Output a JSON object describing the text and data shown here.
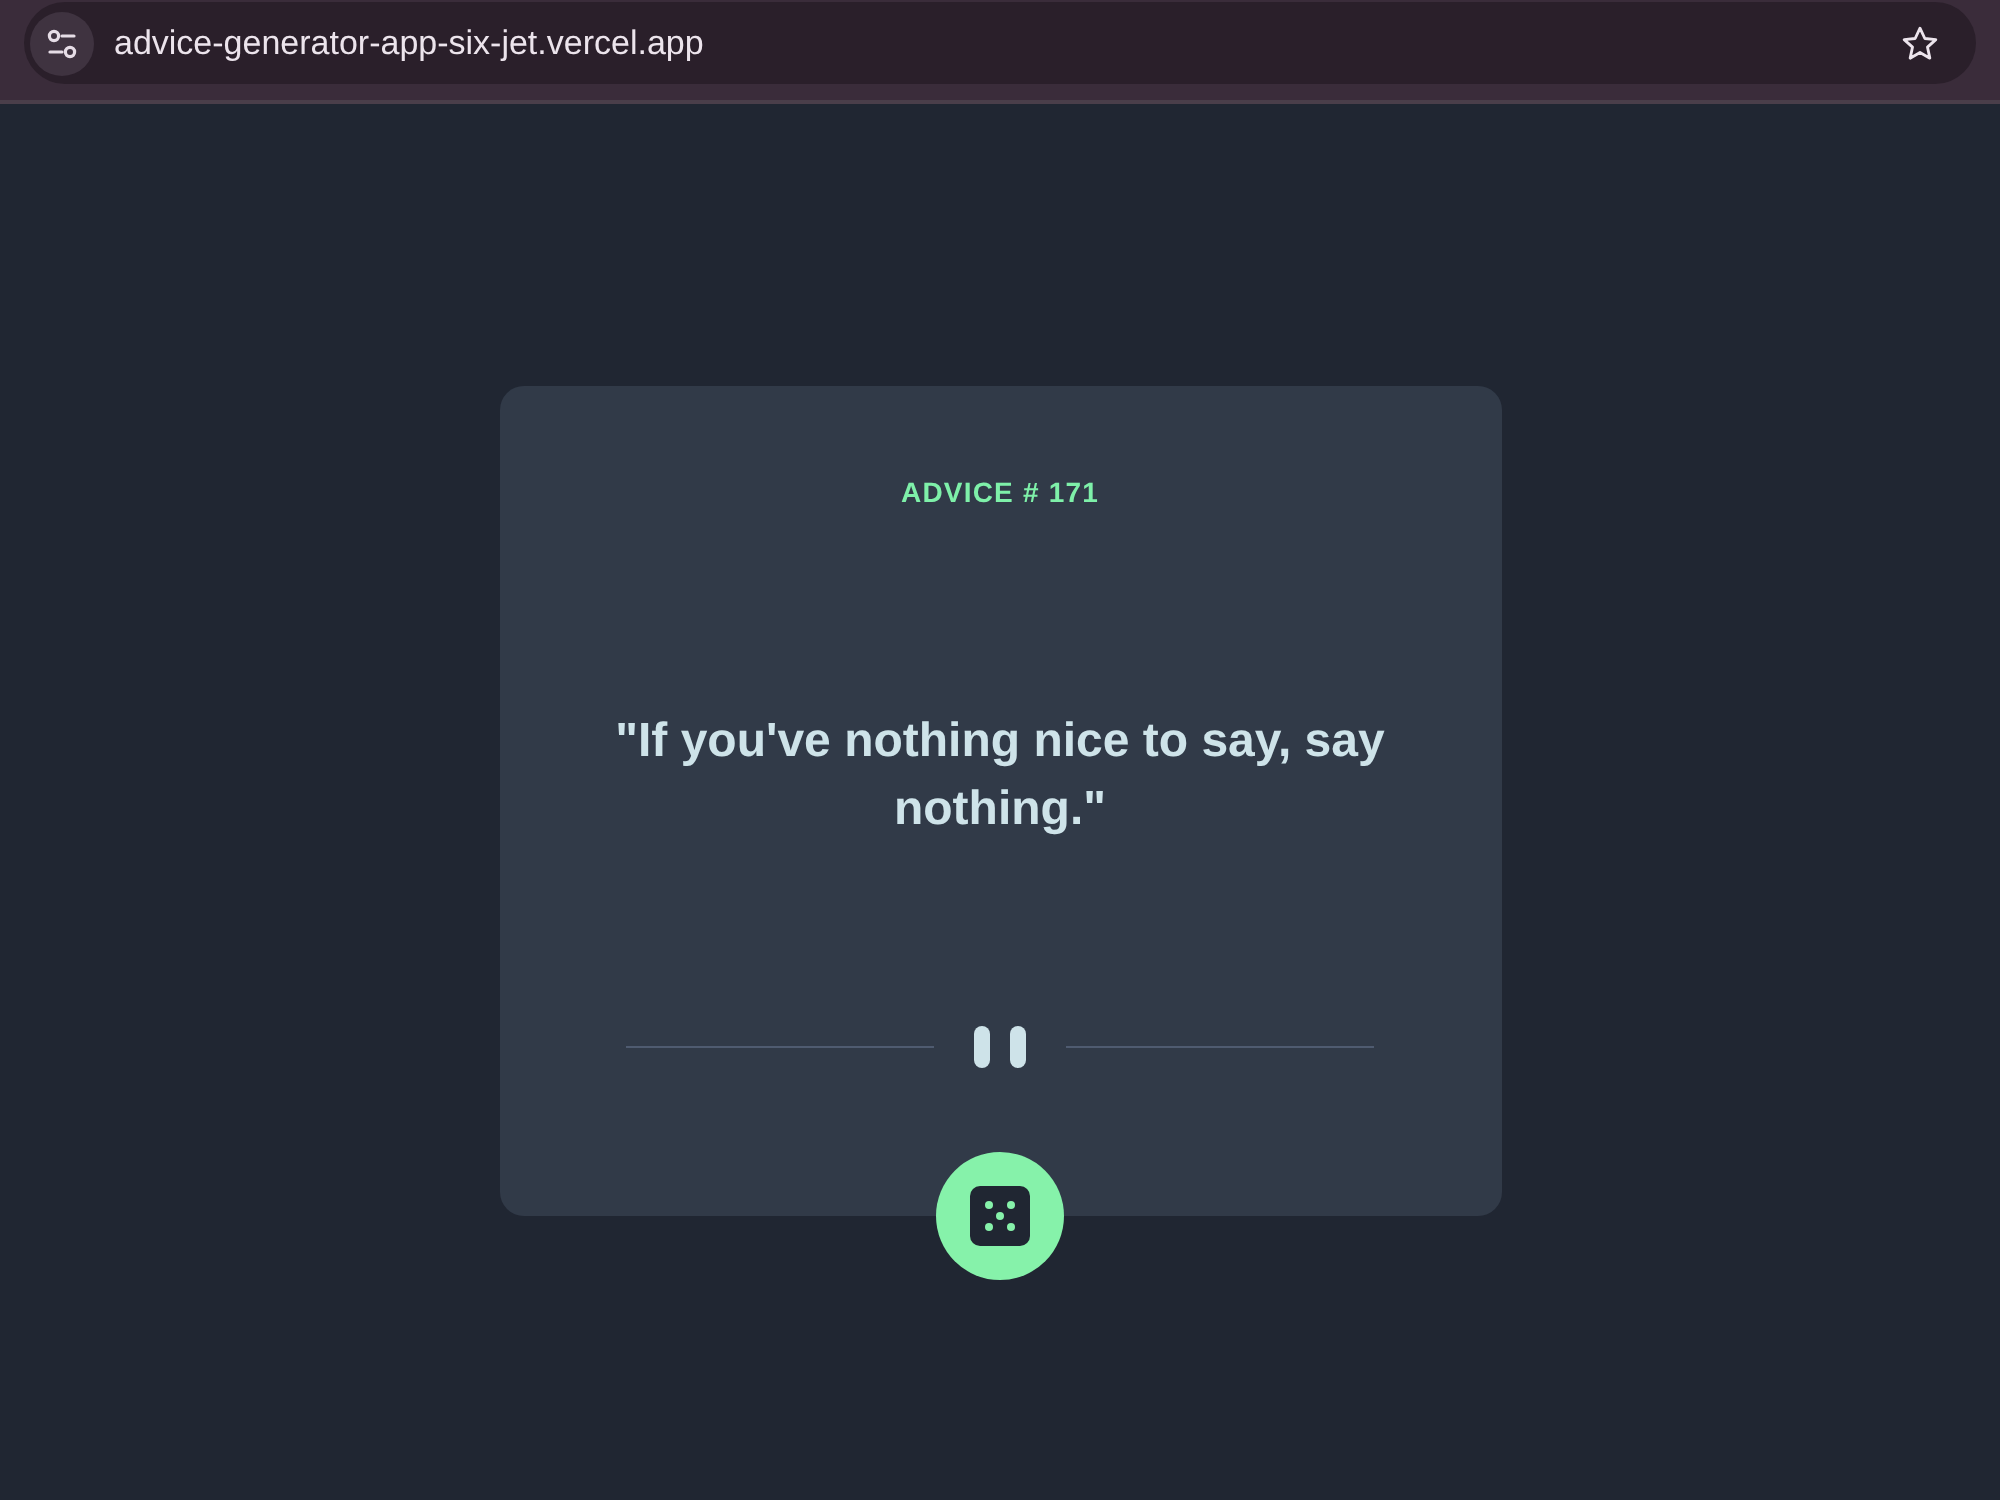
{
  "browser": {
    "url": "advice-generator-app-six-jet.vercel.app"
  },
  "card": {
    "title": "ADVICE # 171",
    "quote": "\"If you've nothing nice to say, say nothing.\""
  }
}
